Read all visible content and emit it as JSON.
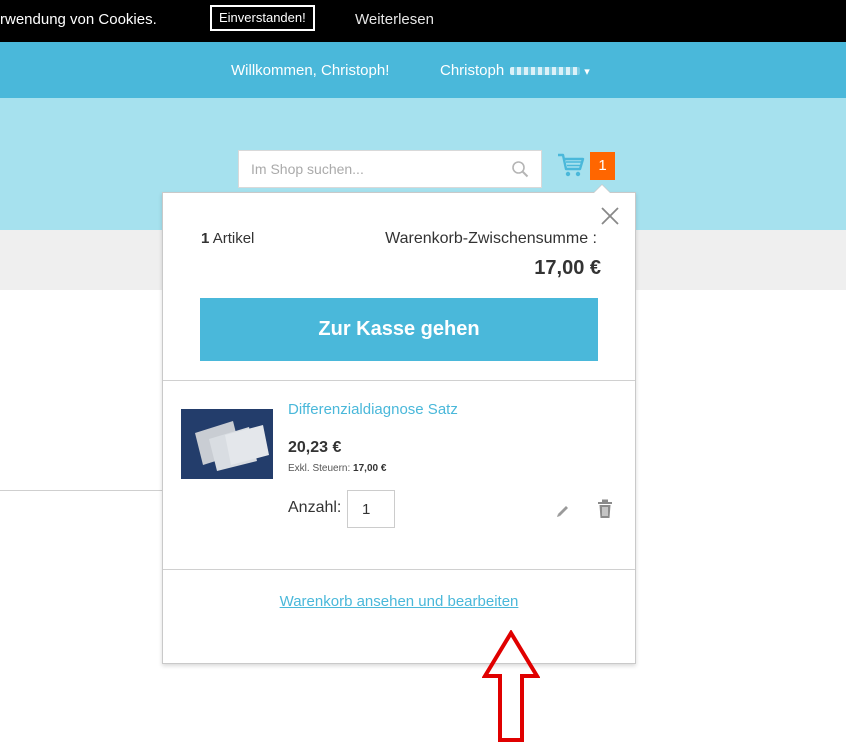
{
  "cookie_bar": {
    "text": "rwendung von Cookies.",
    "accept_label": "Einverstanden!",
    "more_label": "Weiterlesen"
  },
  "header": {
    "welcome": "Willkommen, Christoph!",
    "account_name": "Christoph",
    "account_menu_icon": "chevron-down-icon"
  },
  "search": {
    "placeholder": "Im Shop suchen...",
    "icon": "search-icon"
  },
  "cart": {
    "icon": "shopping-cart-icon",
    "count": "1"
  },
  "minicart": {
    "items_count_number": "1",
    "items_count_label": "Artikel",
    "subtotal_label": "Warenkorb-Zwischensumme :",
    "subtotal_value": "17,00 €",
    "checkout_label": "Zur Kasse gehen",
    "item": {
      "name": "Differenzialdiagnose Satz",
      "price": "20,23 €",
      "tax_label": "Exkl. Steuern:",
      "tax_value": "17,00 €",
      "qty_label": "Anzahl:",
      "qty_value": "1"
    },
    "view_cart_label": "Warenkorb ansehen und bearbeiten"
  },
  "colors": {
    "cookie_bar": "#000000",
    "welcome_bar": "#4ab8da",
    "header_band": "#a6e1ee",
    "cart_badge": "#ff6600",
    "annotation_arrow": "#e00000"
  }
}
